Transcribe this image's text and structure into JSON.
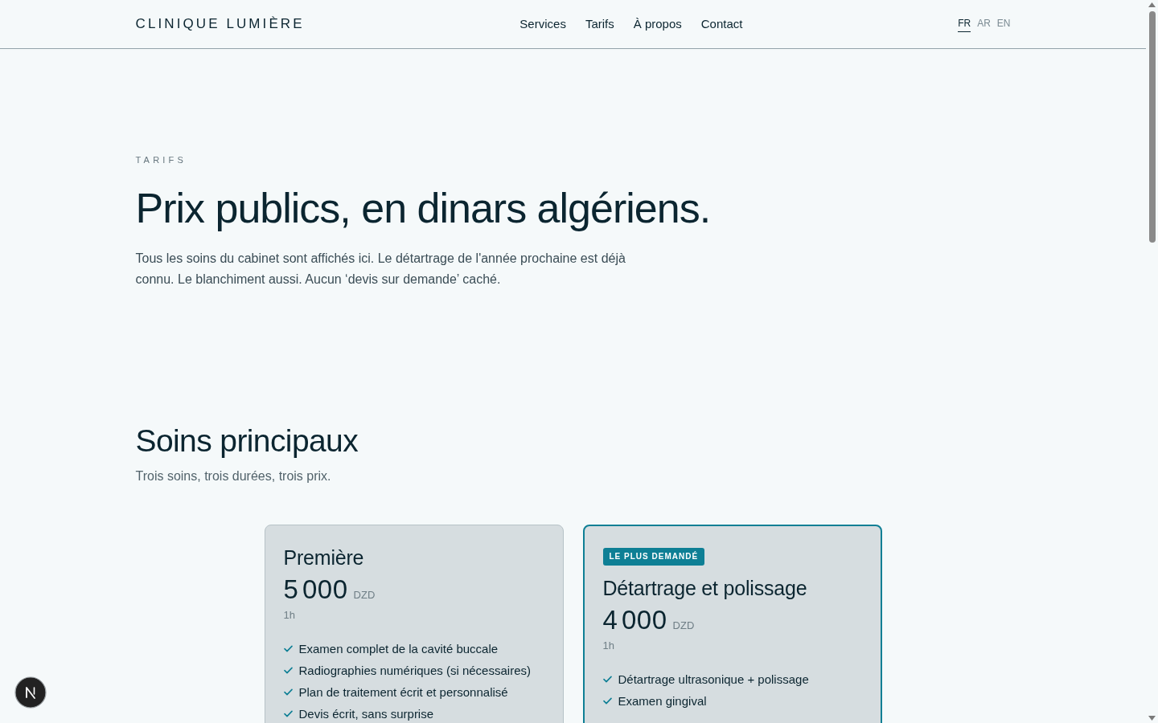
{
  "header": {
    "logo": "CLINIQUE LUMIÈRE",
    "nav": [
      {
        "label": "Services"
      },
      {
        "label": "Tarifs"
      },
      {
        "label": "À propos"
      },
      {
        "label": "Contact"
      }
    ],
    "languages": [
      {
        "label": "FR",
        "selected": true
      },
      {
        "label": "AR",
        "selected": false
      },
      {
        "label": "EN",
        "selected": false
      }
    ]
  },
  "hero": {
    "eyebrow": "TARIFS",
    "title": "Prix publics, en dinars algériens.",
    "intro": "Tous les soins du cabinet sont affichés ici. Le détartrage de l'année prochaine est déjà connu. Le blanchiment aussi. Aucun ‘devis sur demande’ caché."
  },
  "pricing": {
    "title": "Soins principaux",
    "subtitle": "Trois soins, trois durées, trois prix.",
    "plans": [
      {
        "featured": false,
        "name": "Première",
        "price": "5 000",
        "currency": "DZD",
        "duration": "1h",
        "features": [
          "Examen complet de la cavité buccale",
          "Radiographies numériques (si nécessaires)",
          "Plan de traitement écrit et personnalisé",
          "Devis écrit, sans surprise"
        ]
      },
      {
        "featured": true,
        "badge": "LE PLUS DEMANDÉ",
        "name": "Détartrage et polissage",
        "price": "4 000",
        "currency": "DZD",
        "duration": "1h",
        "features": [
          "Détartrage ultrasonique + polissage",
          "Examen gingival"
        ]
      }
    ]
  }
}
